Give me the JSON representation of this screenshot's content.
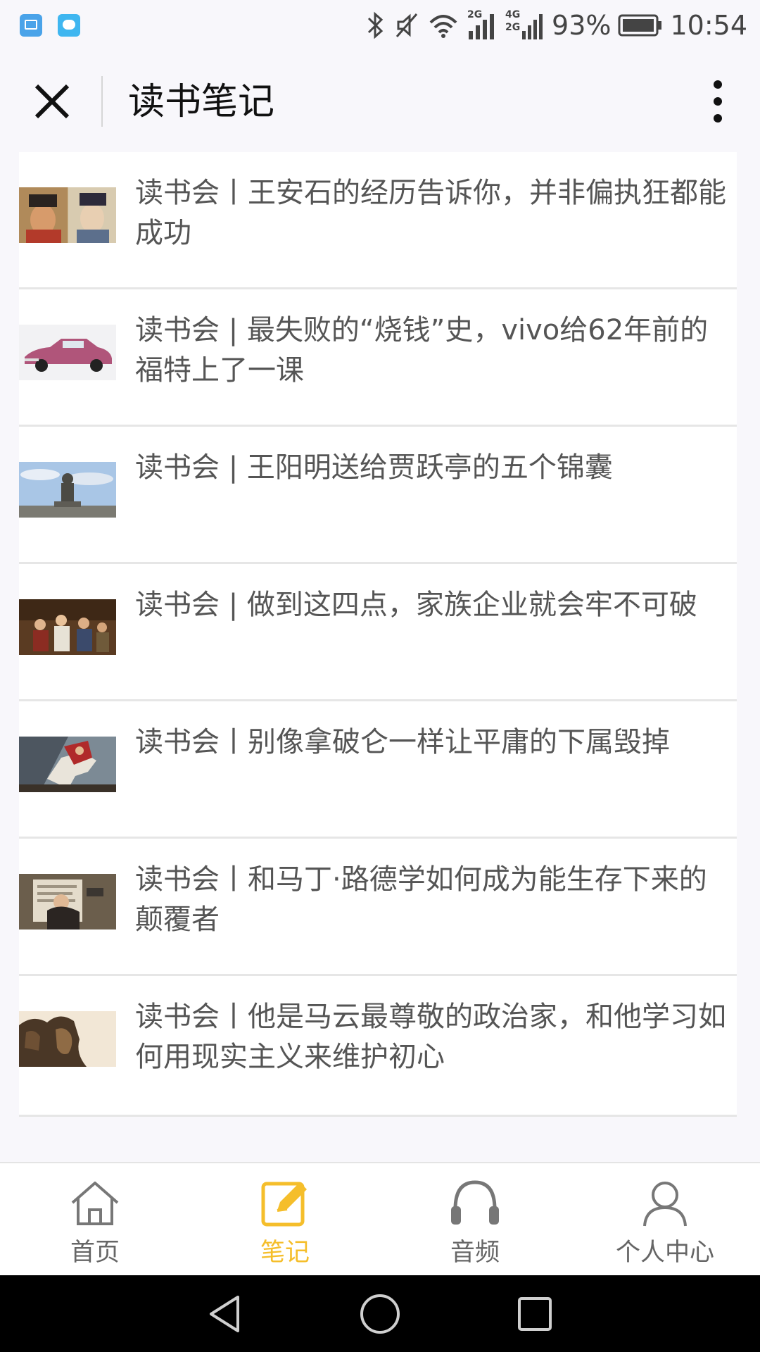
{
  "status_bar": {
    "battery": "93%",
    "time": "10:54",
    "network_2g": "2G",
    "network_4g": "4G",
    "network_2g_b": "2G"
  },
  "header": {
    "title": "读书笔记"
  },
  "articles": [
    {
      "title": "读书会丨王安石的经历告诉你，并非偏执狂都能成功",
      "thumb_icon": "portrait-painting-thumbnail"
    },
    {
      "title": "读书会 | 最失败的“烧钱”史，vivo给62年前的福特上了一课",
      "thumb_icon": "classic-car-thumbnail"
    },
    {
      "title": "读书会 | 王阳明送给贾跃亭的五个锦囊",
      "thumb_icon": "statue-thumbnail"
    },
    {
      "title": "读书会 | 做到这四点，家族企业就会牢不可破",
      "thumb_icon": "family-painting-thumbnail"
    },
    {
      "title": "读书会丨别像拿破仑一样让平庸的下属毁掉",
      "thumb_icon": "napoleon-painting-thumbnail"
    },
    {
      "title": "读书会丨和马丁·路德学如何成为能生存下来的颠覆者",
      "thumb_icon": "martin-luther-thumbnail"
    },
    {
      "title": "读书会丨他是马云最尊敬的政治家，和他学习如何用现实主义来维护初心",
      "thumb_icon": "mount-rushmore-thumbnail"
    }
  ],
  "tab_bar": {
    "tabs": [
      {
        "label": "首页",
        "icon": "home-icon",
        "active": false
      },
      {
        "label": "笔记",
        "icon": "note-edit-icon",
        "active": true
      },
      {
        "label": "音频",
        "icon": "headphones-icon",
        "active": false
      },
      {
        "label": "个人中心",
        "icon": "person-icon",
        "active": false
      }
    ]
  },
  "colors": {
    "accent": "#f5be2b",
    "tab_inactive": "#666666",
    "background": "#f8f7fb"
  }
}
